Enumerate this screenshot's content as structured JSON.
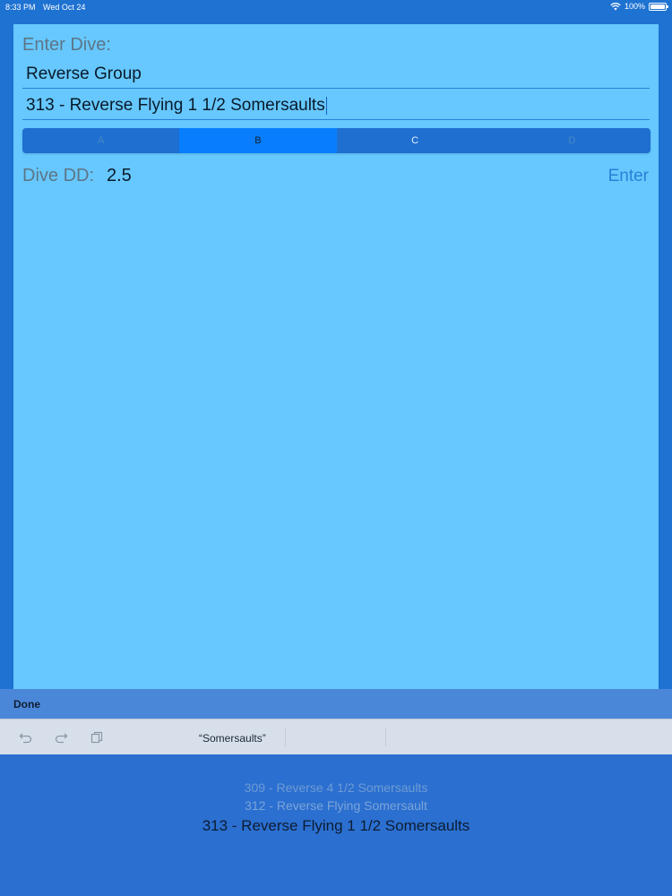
{
  "status_bar": {
    "time": "8:33 PM",
    "date": "Wed Oct 24",
    "battery": "100%"
  },
  "form": {
    "enter_dive_label": "Enter Dive:",
    "group_value": "Reverse Group",
    "dive_value": "313 - Reverse Flying 1 1/2 Somersaults",
    "segments": [
      "A",
      "B",
      "C",
      "D"
    ],
    "selected_segment": "B",
    "dd_label": "Dive DD:",
    "dd_value": "2.5",
    "enter_label": "Enter"
  },
  "toolbar": {
    "done_label": "Done"
  },
  "shortcut_bar": {
    "suggestion": "“Somersaults”"
  },
  "picker": {
    "rows": [
      "309 - Reverse 4 1/2 Somersaults",
      "312 - Reverse Flying Somersault",
      "313 - Reverse Flying 1 1/2 Somersaults"
    ]
  },
  "colors": {
    "background": "#1e72d2",
    "panel": "#66c8fe",
    "accent": "#087eff",
    "link": "#2a7fd8"
  }
}
